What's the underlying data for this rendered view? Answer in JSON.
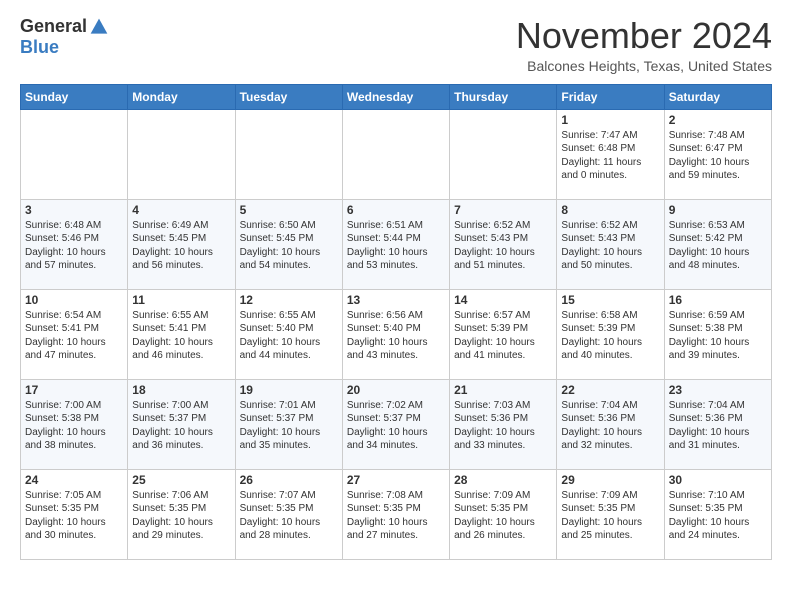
{
  "header": {
    "logo_general": "General",
    "logo_blue": "Blue",
    "month": "November 2024",
    "location": "Balcones Heights, Texas, United States"
  },
  "columns": [
    "Sunday",
    "Monday",
    "Tuesday",
    "Wednesday",
    "Thursday",
    "Friday",
    "Saturday"
  ],
  "weeks": [
    [
      {
        "day": "",
        "info": ""
      },
      {
        "day": "",
        "info": ""
      },
      {
        "day": "",
        "info": ""
      },
      {
        "day": "",
        "info": ""
      },
      {
        "day": "",
        "info": ""
      },
      {
        "day": "1",
        "info": "Sunrise: 7:47 AM\nSunset: 6:48 PM\nDaylight: 11 hours\nand 0 minutes."
      },
      {
        "day": "2",
        "info": "Sunrise: 7:48 AM\nSunset: 6:47 PM\nDaylight: 10 hours\nand 59 minutes."
      }
    ],
    [
      {
        "day": "3",
        "info": "Sunrise: 6:48 AM\nSunset: 5:46 PM\nDaylight: 10 hours\nand 57 minutes."
      },
      {
        "day": "4",
        "info": "Sunrise: 6:49 AM\nSunset: 5:45 PM\nDaylight: 10 hours\nand 56 minutes."
      },
      {
        "day": "5",
        "info": "Sunrise: 6:50 AM\nSunset: 5:45 PM\nDaylight: 10 hours\nand 54 minutes."
      },
      {
        "day": "6",
        "info": "Sunrise: 6:51 AM\nSunset: 5:44 PM\nDaylight: 10 hours\nand 53 minutes."
      },
      {
        "day": "7",
        "info": "Sunrise: 6:52 AM\nSunset: 5:43 PM\nDaylight: 10 hours\nand 51 minutes."
      },
      {
        "day": "8",
        "info": "Sunrise: 6:52 AM\nSunset: 5:43 PM\nDaylight: 10 hours\nand 50 minutes."
      },
      {
        "day": "9",
        "info": "Sunrise: 6:53 AM\nSunset: 5:42 PM\nDaylight: 10 hours\nand 48 minutes."
      }
    ],
    [
      {
        "day": "10",
        "info": "Sunrise: 6:54 AM\nSunset: 5:41 PM\nDaylight: 10 hours\nand 47 minutes."
      },
      {
        "day": "11",
        "info": "Sunrise: 6:55 AM\nSunset: 5:41 PM\nDaylight: 10 hours\nand 46 minutes."
      },
      {
        "day": "12",
        "info": "Sunrise: 6:55 AM\nSunset: 5:40 PM\nDaylight: 10 hours\nand 44 minutes."
      },
      {
        "day": "13",
        "info": "Sunrise: 6:56 AM\nSunset: 5:40 PM\nDaylight: 10 hours\nand 43 minutes."
      },
      {
        "day": "14",
        "info": "Sunrise: 6:57 AM\nSunset: 5:39 PM\nDaylight: 10 hours\nand 41 minutes."
      },
      {
        "day": "15",
        "info": "Sunrise: 6:58 AM\nSunset: 5:39 PM\nDaylight: 10 hours\nand 40 minutes."
      },
      {
        "day": "16",
        "info": "Sunrise: 6:59 AM\nSunset: 5:38 PM\nDaylight: 10 hours\nand 39 minutes."
      }
    ],
    [
      {
        "day": "17",
        "info": "Sunrise: 7:00 AM\nSunset: 5:38 PM\nDaylight: 10 hours\nand 38 minutes."
      },
      {
        "day": "18",
        "info": "Sunrise: 7:00 AM\nSunset: 5:37 PM\nDaylight: 10 hours\nand 36 minutes."
      },
      {
        "day": "19",
        "info": "Sunrise: 7:01 AM\nSunset: 5:37 PM\nDaylight: 10 hours\nand 35 minutes."
      },
      {
        "day": "20",
        "info": "Sunrise: 7:02 AM\nSunset: 5:37 PM\nDaylight: 10 hours\nand 34 minutes."
      },
      {
        "day": "21",
        "info": "Sunrise: 7:03 AM\nSunset: 5:36 PM\nDaylight: 10 hours\nand 33 minutes."
      },
      {
        "day": "22",
        "info": "Sunrise: 7:04 AM\nSunset: 5:36 PM\nDaylight: 10 hours\nand 32 minutes."
      },
      {
        "day": "23",
        "info": "Sunrise: 7:04 AM\nSunset: 5:36 PM\nDaylight: 10 hours\nand 31 minutes."
      }
    ],
    [
      {
        "day": "24",
        "info": "Sunrise: 7:05 AM\nSunset: 5:35 PM\nDaylight: 10 hours\nand 30 minutes."
      },
      {
        "day": "25",
        "info": "Sunrise: 7:06 AM\nSunset: 5:35 PM\nDaylight: 10 hours\nand 29 minutes."
      },
      {
        "day": "26",
        "info": "Sunrise: 7:07 AM\nSunset: 5:35 PM\nDaylight: 10 hours\nand 28 minutes."
      },
      {
        "day": "27",
        "info": "Sunrise: 7:08 AM\nSunset: 5:35 PM\nDaylight: 10 hours\nand 27 minutes."
      },
      {
        "day": "28",
        "info": "Sunrise: 7:09 AM\nSunset: 5:35 PM\nDaylight: 10 hours\nand 26 minutes."
      },
      {
        "day": "29",
        "info": "Sunrise: 7:09 AM\nSunset: 5:35 PM\nDaylight: 10 hours\nand 25 minutes."
      },
      {
        "day": "30",
        "info": "Sunrise: 7:10 AM\nSunset: 5:35 PM\nDaylight: 10 hours\nand 24 minutes."
      }
    ]
  ]
}
